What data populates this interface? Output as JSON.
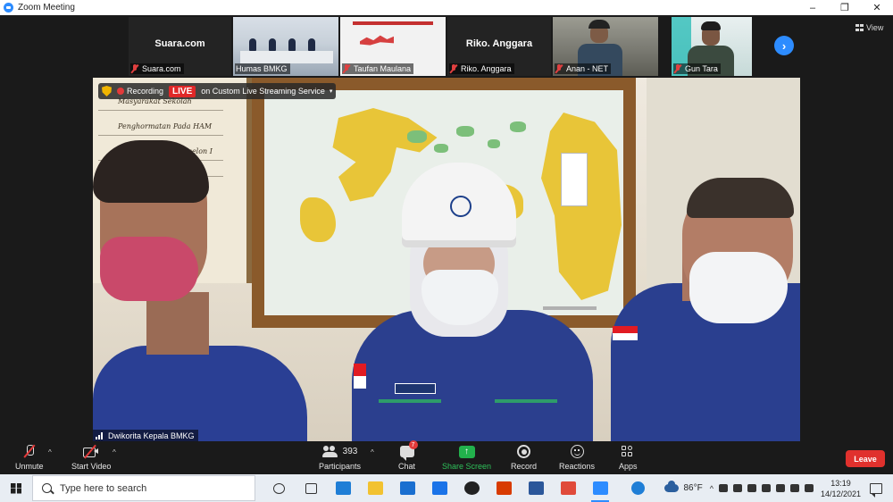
{
  "window": {
    "title": "Zoom Meeting",
    "controls": [
      "–",
      "❐",
      "✕"
    ],
    "view_label": "View"
  },
  "thumbnails": [
    {
      "display": "Suara.com",
      "name": "Suara.com",
      "muted": true,
      "video": false
    },
    {
      "display": "",
      "name": "Humas BMKG",
      "muted": false,
      "video": true,
      "video_kind": "conference-room"
    },
    {
      "display": "",
      "name": "Taufan Maulana",
      "muted": true,
      "video": true,
      "video_kind": "slide-map"
    },
    {
      "display": "Riko. Anggara",
      "name": "Riko. Anggara",
      "muted": true,
      "video": false
    },
    {
      "display": "",
      "name": "Anan - NET",
      "muted": true,
      "video": true,
      "video_kind": "person"
    },
    {
      "display": "",
      "name": "Gun Tara",
      "muted": true,
      "video": true,
      "video_kind": "person"
    }
  ],
  "next_arrow": "›",
  "recording": {
    "status_text": "Recording",
    "live_label": "LIVE",
    "stream_text": "on Custom Live Streaming Service",
    "caret": "▾"
  },
  "main_video": {
    "speaker_name": "Dwikorita Kepala BMKG",
    "board_lines": [
      "Masyarakat Sekolah",
      "Penghormatan Pada HAM",
      "Kerjasama Lintas Eselon I"
    ]
  },
  "toolbar": {
    "unmute_label": "Unmute",
    "start_video_label": "Start Video",
    "participants_label": "Participants",
    "participants_count": "393",
    "chat_label": "Chat",
    "chat_badge": "7",
    "share_label": "Share Screen",
    "share_glyph": "↑",
    "record_label": "Record",
    "reactions_label": "Reactions",
    "apps_label": "Apps",
    "leave_label": "Leave",
    "caret": "^"
  },
  "taskbar": {
    "search_placeholder": "Type here to search",
    "apps": [
      {
        "name": "task-view-icon",
        "color": "#333333"
      },
      {
        "name": "widgets-icon",
        "color": "#333333"
      },
      {
        "name": "edge-icon",
        "color": "#1f7ed6"
      },
      {
        "name": "file-explorer-icon",
        "color": "#f2c230"
      },
      {
        "name": "mail-icon",
        "color": "#1a6fd0"
      },
      {
        "name": "dropbox-icon",
        "color": "#1a73e8"
      },
      {
        "name": "github-icon",
        "color": "#222222"
      },
      {
        "name": "office-icon",
        "color": "#d83b01"
      },
      {
        "name": "word-icon",
        "color": "#2b579a"
      },
      {
        "name": "chrome-icon",
        "color": "#e04a3a"
      },
      {
        "name": "zoom-icon",
        "color": "#2d8cff"
      }
    ],
    "help_icon_color": "#1f7ed6",
    "temperature": "86°F",
    "tray_chevron": "^",
    "time": "13:19",
    "date": "14/12/2021"
  },
  "colors": {
    "zoom_blue": "#2d8cff",
    "live_red": "#e02828",
    "share_green": "#22b14c",
    "leave_red": "#e0312d"
  }
}
